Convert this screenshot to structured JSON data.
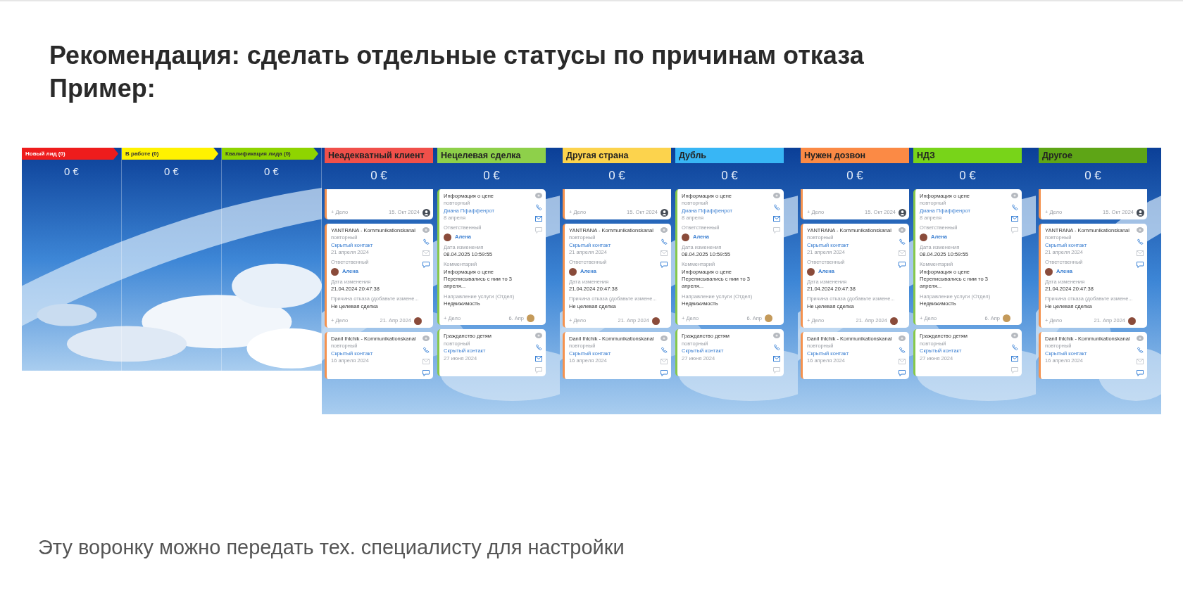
{
  "heading": [
    "Рекомендация: сделать отдельные статусы по причинам отказа",
    "Пример:"
  ],
  "old_board": {
    "columns": [
      {
        "title": "Новый лид (0)",
        "color": "#ee1c1c",
        "total": "0 €"
      },
      {
        "title": "В работе (0)",
        "color": "#fff200",
        "total": "0 €"
      },
      {
        "title": "Квалификация лида (0)",
        "color": "#8fd400",
        "total": "0 €"
      }
    ]
  },
  "panels": [
    {
      "columns": [
        {
          "title": "Неадекватный клиент",
          "color": "#f0504a",
          "total": "0 €",
          "cards": [
            {
              "kind": "stub",
              "action": "+ Дело",
              "due": "15. Окт 2024"
            },
            {
              "kind": "deal",
              "title": "YANTRANA - Kommunikationskanal",
              "tag": "повторный",
              "contact": "Скрытый контакт",
              "date": "21 апреля 2024",
              "owner_label": "Ответственный",
              "owner": "Алена",
              "fields": [
                {
                  "label": "Дата изменения",
                  "value": "21.04.2024 20:47:38"
                },
                {
                  "label": "Причина отказа (добавьте измене...",
                  "value": "Не целевая сделка"
                }
              ],
              "action": "+ Дело",
              "due": "21. Апр 2024"
            },
            {
              "kind": "deal",
              "title": "Danil Ihlchik - Kommunikationskanal",
              "tag": "повторный",
              "contact": "Скрытый контакт",
              "date": "16 апреля 2024"
            }
          ]
        },
        {
          "title": "Нецелевая сделка",
          "color": "#8ed04a",
          "total": "0 €",
          "cards": [
            {
              "kind": "info",
              "title": "Информация о цене",
              "tag": "повторный",
              "contact": "Диана Пфаффенрот",
              "date": "8 апреля",
              "owner_label": "Ответственный",
              "owner": "Алена",
              "fields": [
                {
                  "label": "Дата изменения",
                  "value": "08.04.2025 10:59:55"
                },
                {
                  "label": "Комментарий",
                  "value": "Информация о цене Переписывались с ним то 3 апреля..."
                },
                {
                  "label": "Направление услуги (Отдел)",
                  "value": "Недвижимость"
                }
              ],
              "action": "+ Дело",
              "due": "6. Апр"
            },
            {
              "kind": "info",
              "title": "Гражданство детям",
              "tag": "повторный",
              "contact": "Скрытый контакт",
              "date": "27 июня 2024"
            }
          ]
        }
      ]
    },
    {
      "columns": [
        {
          "title": "Другая страна",
          "color": "#fcd34d",
          "total": "0 €",
          "cards": [
            {
              "kind": "stub",
              "action": "+ Дело",
              "due": "15. Окт 2024"
            },
            {
              "kind": "deal",
              "title": "YANTRANA - Kommunikationskanal",
              "tag": "повторный",
              "contact": "Скрытый контакт",
              "date": "21 апреля 2024",
              "owner_label": "Ответственный",
              "owner": "Алена",
              "fields": [
                {
                  "label": "Дата изменения",
                  "value": "21.04.2024 20:47:38"
                },
                {
                  "label": "Причина отказа (добавьте измене...",
                  "value": "Не целевая сделка"
                }
              ],
              "action": "+ Дело",
              "due": "21. Апр 2024"
            },
            {
              "kind": "deal",
              "title": "Danil Ihlchik - Kommunikationskanal",
              "tag": "повторный",
              "contact": "Скрытый контакт",
              "date": "16 апреля 2024"
            }
          ]
        },
        {
          "title": "Дубль",
          "color": "#38b6f5",
          "total": "0 €",
          "cards": [
            {
              "kind": "info",
              "title": "Информация о цене",
              "tag": "повторный",
              "contact": "Диана Пфаффенрот",
              "date": "8 апреля",
              "owner_label": "Ответственный",
              "owner": "Алена",
              "fields": [
                {
                  "label": "Дата изменения",
                  "value": "08.04.2025 10:59:55"
                },
                {
                  "label": "Комментарий",
                  "value": "Информация о цене Переписывались с ним то 3 апреля..."
                },
                {
                  "label": "Направление услуги (Отдел)",
                  "value": "Недвижимость"
                }
              ],
              "action": "+ Дело",
              "due": "6. Апр"
            },
            {
              "kind": "info",
              "title": "Гражданство детям",
              "tag": "повторный",
              "contact": "Скрытый контакт",
              "date": "27 июня 2024"
            }
          ]
        }
      ]
    },
    {
      "columns": [
        {
          "title": "Нужен дозвон",
          "color": "#fb8a45",
          "total": "0 €",
          "cards": [
            {
              "kind": "stub",
              "action": "+ Дело",
              "due": "15. Окт 2024"
            },
            {
              "kind": "deal",
              "title": "YANTRANA - Kommunikationskanal",
              "tag": "повторный",
              "contact": "Скрытый контакт",
              "date": "21 апреля 2024",
              "owner_label": "Ответственный",
              "owner": "Алена",
              "fields": [
                {
                  "label": "Дата изменения",
                  "value": "21.04.2024 20:47:38"
                },
                {
                  "label": "Причина отказа (добавьте измене...",
                  "value": "Не целевая сделка"
                }
              ],
              "action": "+ Дело",
              "due": "21. Апр 2024"
            },
            {
              "kind": "deal",
              "title": "Danil Ihlchik - Kommunikationskanal",
              "tag": "повторный",
              "contact": "Скрытый контакт",
              "date": "16 апреля 2024"
            }
          ]
        },
        {
          "title": "НДЗ",
          "color": "#78d419",
          "total": "0 €",
          "cards": [
            {
              "kind": "info",
              "title": "Информация о цене",
              "tag": "повторный",
              "contact": "Диана Пфаффенрот",
              "date": "8 апреля",
              "owner_label": "Ответственный",
              "owner": "Алена",
              "fields": [
                {
                  "label": "Дата изменения",
                  "value": "08.04.2025 10:59:55"
                },
                {
                  "label": "Комментарий",
                  "value": "Информация о цене Переписывались с ним то 3 апреля..."
                },
                {
                  "label": "Направление услуги (Отдел)",
                  "value": "Недвижимость"
                }
              ],
              "action": "+ Дело",
              "due": "6. Апр"
            },
            {
              "kind": "info",
              "title": "Гражданство детям",
              "tag": "повторный",
              "contact": "Скрытый контакт",
              "date": "27 июня 2024"
            }
          ]
        }
      ]
    },
    {
      "columns": [
        {
          "title": "Другое",
          "color": "#5ea516",
          "total": "0 €",
          "cards": [
            {
              "kind": "stub",
              "action": "+ Дело",
              "due": "15. Окт 2024"
            },
            {
              "kind": "deal",
              "title": "YANTRANA - Kommunikationskanal",
              "tag": "повторный",
              "contact": "Скрытый контакт",
              "date": "21 апреля 2024",
              "owner_label": "Ответственный",
              "owner": "Алена",
              "fields": [
                {
                  "label": "Дата изменения",
                  "value": "21.04.2024 20:47:38"
                },
                {
                  "label": "Причина отказа (добавьте измене...",
                  "value": "Не целевая сделка"
                }
              ],
              "action": "+ Дело",
              "due": "21. Апр 2024"
            },
            {
              "kind": "deal",
              "title": "Danil Ihlchik - Kommunikationskanal",
              "tag": "повторный",
              "contact": "Скрытый контакт",
              "date": "16 апреля 2024"
            }
          ]
        }
      ]
    }
  ],
  "note": "Эту воронку можно передать тех. специалисту для настройки"
}
